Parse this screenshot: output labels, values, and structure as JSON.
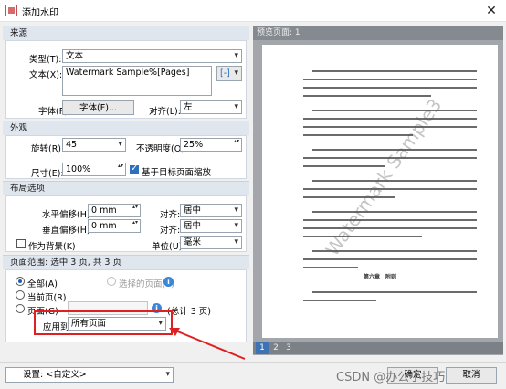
{
  "window": {
    "title": "添加水印",
    "close_glyph": "✕"
  },
  "source": {
    "header": "来源",
    "type_label": "类型(T):",
    "type_value": "文本",
    "text_label": "文本(X):",
    "text_value": "Watermark Sample%[Pages]",
    "macro_glyph": "[-]",
    "font_label": "字体(F):",
    "font_button": "字体(F)...",
    "align_label": "对齐(L):",
    "align_value": "左"
  },
  "appearance": {
    "header": "外观",
    "rotation_label": "旋转(R):",
    "rotation_value": "45",
    "opacity_label": "不透明度(O):",
    "opacity_value": "25%",
    "size_label": "尺寸(E):",
    "size_value": "100%",
    "scale_label": "基于目标页面缩放"
  },
  "layout": {
    "header": "布局选项",
    "h_offset_label": "水平偏移(H):",
    "h_offset_value": "0 mm",
    "h_align_label": "对齐:",
    "h_align_value": "居中",
    "v_offset_label": "垂直偏移(H):",
    "v_offset_value": "0 mm",
    "v_align_label": "对齐:",
    "v_align_value": "居中",
    "background_label": "作为背景(K)",
    "unit_label": "单位(U):",
    "unit_value": "毫米"
  },
  "page_range": {
    "header": "页面范围: 选中 3 页, 共 3 页",
    "all_label": "全部(A)",
    "selected_label": "选择的页面(S)",
    "current_label": "当前页(R)",
    "pages_label": "页面(G)",
    "pages_total": "(总计 3 页)",
    "apply_label": "应用到:",
    "apply_value": "所有页面"
  },
  "preview": {
    "header": "预览页面: 1",
    "watermark_text": "Watermark Sample3",
    "section_title": "第六章　附则",
    "pages": [
      "1",
      "2",
      "3"
    ]
  },
  "footer": {
    "settings_label": "设置:",
    "settings_value": "<自定义>",
    "ok_label": "确定",
    "cancel_label": "取消"
  },
  "overlay": {
    "watermark": "CSDN @办公小技巧"
  },
  "colors": {
    "highlight": "#e02020",
    "accent": "#3d72b5"
  }
}
